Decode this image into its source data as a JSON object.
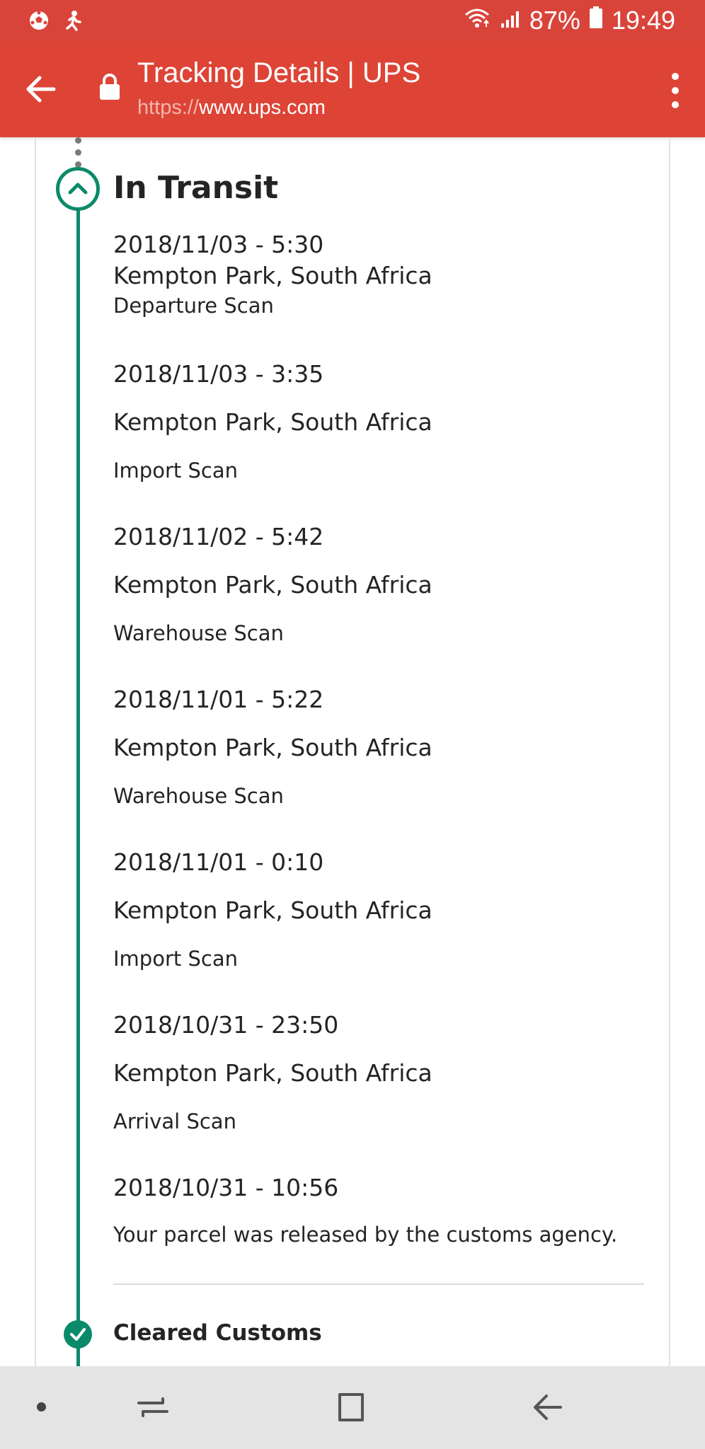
{
  "status_bar": {
    "battery_percent": "87%",
    "time": "19:49",
    "icons": [
      "soccer-ball-icon",
      "running-person-icon",
      "wifi-icon",
      "signal-icon",
      "battery-icon"
    ]
  },
  "browser": {
    "title": "Tracking Details | UPS",
    "url_scheme": "https://",
    "url_host": "www.ups.com",
    "icons": [
      "back-arrow-icon",
      "lock-icon",
      "more-vert-icon"
    ],
    "theme_color": "#dd4436"
  },
  "tracking": {
    "section_title": "In Transit",
    "accent_color": "#0a8a6a",
    "events": [
      {
        "date": "2018/11/03 - 5:30",
        "location": "Kempton Park, South Africa",
        "description": "Departure Scan"
      },
      {
        "date": "2018/11/03 - 3:35",
        "location": "Kempton Park, South Africa",
        "description": "Import Scan"
      },
      {
        "date": "2018/11/02 - 5:42",
        "location": "Kempton Park, South Africa",
        "description": "Warehouse Scan"
      },
      {
        "date": "2018/11/01 - 5:22",
        "location": "Kempton Park, South Africa",
        "description": "Warehouse Scan"
      },
      {
        "date": "2018/11/01 - 0:10",
        "location": "Kempton Park, South Africa",
        "description": "Import Scan"
      },
      {
        "date": "2018/10/31 - 23:50",
        "location": "Kempton Park, South Africa",
        "description": "Arrival Scan"
      },
      {
        "date": "2018/10/31 - 10:56",
        "description": "Your parcel was released by the customs agency."
      }
    ],
    "next_section_title": "Cleared Customs"
  },
  "nav_bar": {
    "icons": [
      "nav-dot-icon",
      "recents-icon",
      "home-icon",
      "back-icon"
    ]
  }
}
